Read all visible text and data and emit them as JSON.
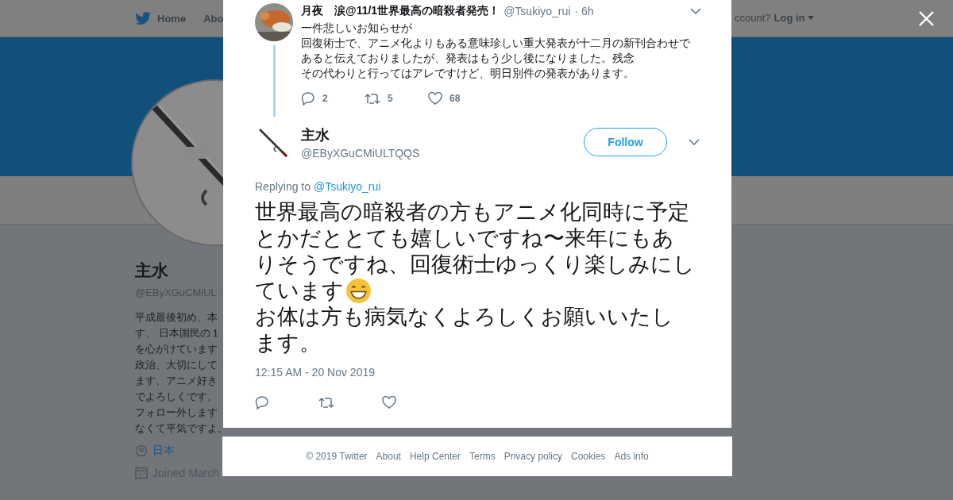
{
  "top_nav": {
    "items": [
      {
        "label": "Home",
        "kind": "home"
      },
      {
        "label": "Abo",
        "kind": "plain"
      }
    ],
    "account_prompt": "ccount?",
    "login": "Log in"
  },
  "profile": {
    "name": "主水",
    "handle": "@EByXGuCMiUL",
    "bio_lines": [
      "平成最後初め、本",
      "す、 日本国民の１",
      "を心がけています",
      "政治、大切にして",
      "ます、アニメ好き",
      "でよろしくです。",
      "フォロー外します",
      "なくて平気ですよ。"
    ],
    "location": "日本",
    "joined": "Joined March"
  },
  "parent_tweet": {
    "name": "月夜　涙@11/1世界最高の暗殺者発売！",
    "handle": "@Tsukiyo_rui",
    "time": "· 6h",
    "text_lines": [
      "一件悲しいお知らせが",
      "回復術士で、アニメ化よりもある意味珍しい重大発表が十二月の新刊合わせで",
      "あると伝えておりましたが、発表はもう少し後になりました。残念",
      "その代わりと行ってはアレですけど、明日別件の発表があります。"
    ],
    "replies": "2",
    "retweets": "5",
    "likes": "68"
  },
  "tweet": {
    "name": "主水",
    "handle": "@EByXGuCMiULTQQS",
    "follow": "Follow",
    "replying_label": "Replying to",
    "replying_to": "@Tsukiyo_rui",
    "paragraphs": [
      [
        "世界最高の暗殺者の方もアニメ化同時に予定",
        "とかだととても嬉しいですね〜来年にもあ",
        "りそうですね、回復術士ゆっくり楽しみにし",
        "ています"
      ],
      [
        "お体は方も病気なくよろしくお願いいたし",
        "ます。"
      ]
    ],
    "timestamp": "12:15 AM - 20 Nov 2019"
  },
  "footer": [
    "© 2019 Twitter",
    "About",
    "Help Center",
    "Terms",
    "Privacy policy",
    "Cookies",
    "Ads info"
  ]
}
